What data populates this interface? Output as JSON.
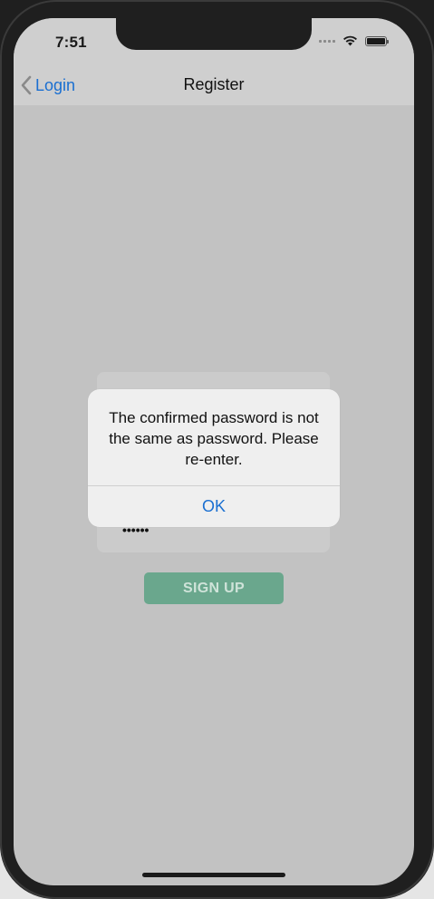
{
  "status_bar": {
    "time": "7:51"
  },
  "nav": {
    "back_label": "Login",
    "title": "Register"
  },
  "form": {
    "password_masked": "••••••",
    "signup_label": "SIGN UP"
  },
  "alert": {
    "message": "The confirmed password is not the same as password. Please re-enter.",
    "ok_label": "OK"
  },
  "colors": {
    "accent": "#1a6fd1",
    "signup_button": "#6aa78d",
    "overlay_background": "#c2c2c2",
    "alert_background": "#efefef"
  },
  "icons": [
    "chevron-left-icon",
    "cellular-signal-icon",
    "wifi-icon",
    "battery-icon"
  ]
}
